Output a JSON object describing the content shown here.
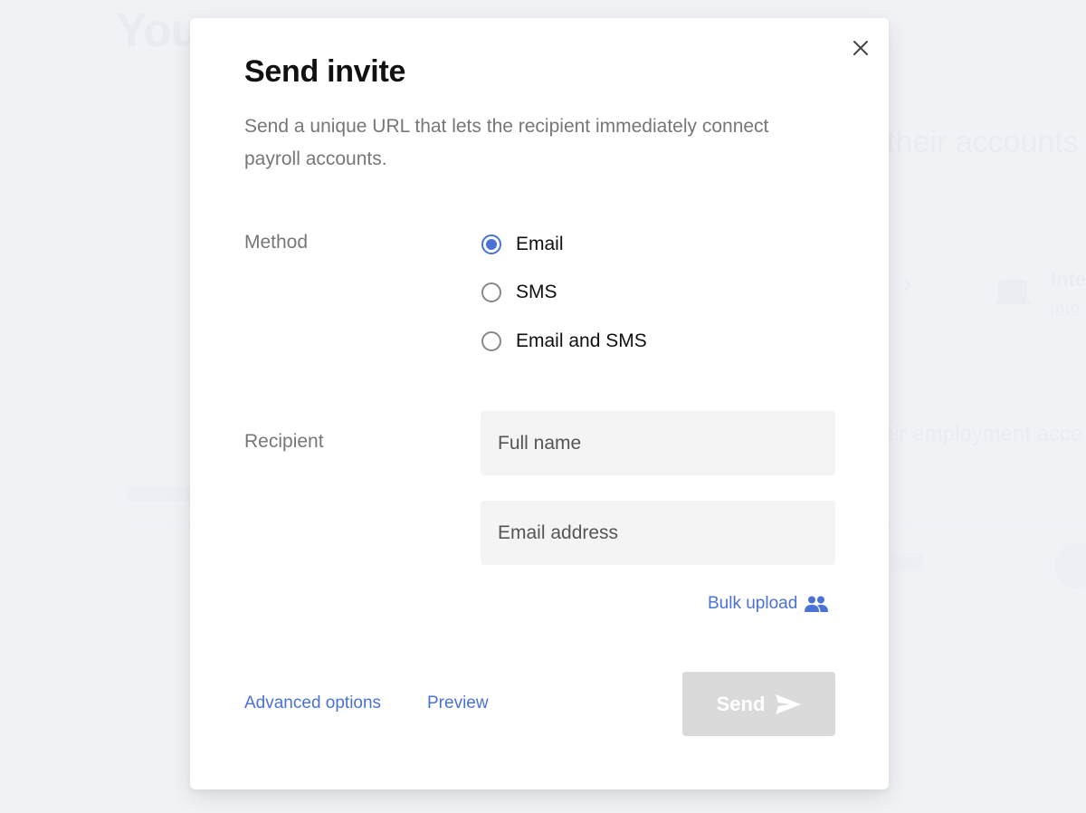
{
  "background": {
    "title_fragment": "You",
    "subtitle_fragment": "their accounts",
    "item_title_fragment": "Inte",
    "item_sub_fragment": "into",
    "description_fragment": "eir employment acco"
  },
  "modal": {
    "title": "Send invite",
    "description": "Send a unique URL that lets the recipient immediately connect payroll accounts.",
    "close_icon": "close-icon",
    "method": {
      "label": "Method",
      "options": [
        {
          "label": "Email",
          "checked": true
        },
        {
          "label": "SMS",
          "checked": false
        },
        {
          "label": "Email and SMS",
          "checked": false
        }
      ]
    },
    "recipient": {
      "label": "Recipient",
      "full_name": {
        "value": "",
        "placeholder": "Full name"
      },
      "email": {
        "value": "",
        "placeholder": "Email address"
      }
    },
    "bulk_upload": {
      "label": "Bulk upload",
      "icon": "people-icon"
    },
    "footer": {
      "advanced_options": "Advanced options",
      "preview": "Preview",
      "send": "Send",
      "send_icon": "send-icon",
      "send_disabled": true
    }
  },
  "colors": {
    "accent": "#4a72d6",
    "disabled_button": "#dadada",
    "input_bg": "#f4f4f4",
    "label_gray": "#777777"
  }
}
